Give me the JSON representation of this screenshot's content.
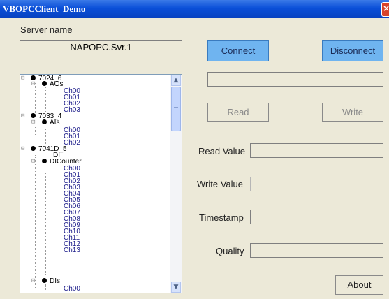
{
  "window": {
    "title": "VBOPCClient_Demo",
    "close_glyph": "×"
  },
  "server": {
    "label": "Server name",
    "value": "NAPOPC.Svr.1"
  },
  "buttons": {
    "connect": "Connect",
    "disconnect": "Disconnect",
    "read": "Read",
    "write": "Write",
    "about": "About"
  },
  "fields": {
    "read_value_label": "Read Value",
    "write_value_label": "Write Value",
    "timestamp_label": "Timestamp",
    "quality_label": "Quality"
  },
  "tree": {
    "n7024": "7024_6",
    "aos": "AOs",
    "aos_ch": [
      "Ch00",
      "Ch01",
      "Ch02",
      "Ch03"
    ],
    "n7033": "7033_4",
    "ais": "AIs",
    "ais_ch": [
      "Ch00",
      "Ch01",
      "Ch02"
    ],
    "n7041": "7041D_5",
    "di": "DI",
    "dicounter": "DICounter",
    "dic_ch": [
      "Ch00",
      "Ch01",
      "Ch02",
      "Ch03",
      "Ch04",
      "Ch05",
      "Ch06",
      "Ch07",
      "Ch08",
      "Ch09",
      "Ch10",
      "Ch11",
      "Ch12",
      "Ch13"
    ],
    "dis": "DIs",
    "dis_ch0": "Ch00"
  },
  "colors": {
    "title_bar": "#0a4fd8",
    "button_blue": "#6fb4f0",
    "face": "#ece9d8",
    "channel_text": "#1c1c8a"
  }
}
